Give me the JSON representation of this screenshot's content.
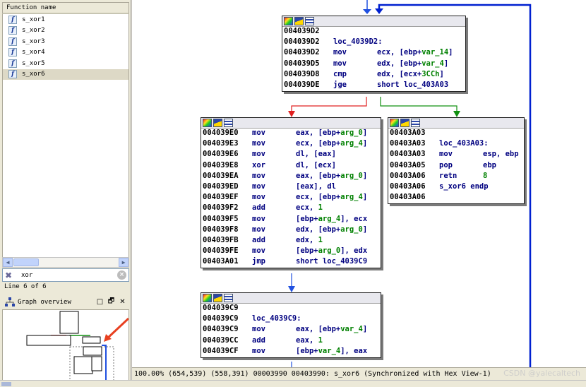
{
  "functions_panel": {
    "header": "Function name",
    "items": [
      {
        "name": "s_xor1"
      },
      {
        "name": "s_xor2"
      },
      {
        "name": "s_xor3"
      },
      {
        "name": "s_xor4"
      },
      {
        "name": "s_xor5"
      },
      {
        "name": "s_xor6",
        "selected": true
      }
    ],
    "filter_value": "xor",
    "line_status": "Line 6 of 6"
  },
  "graph_overview": {
    "title": "Graph overview",
    "controls": [
      "□",
      "🗗",
      "✕"
    ]
  },
  "graph": {
    "nodes": [
      {
        "id": "loc_4039D2",
        "lines": [
          {
            "addr": "004039D2"
          },
          {
            "addr": "004039D2",
            "label": "loc_4039D2:"
          },
          {
            "addr": "004039D2",
            "mn": "mov",
            "ops": [
              {
                "t": "ecx, [ebp+"
              },
              {
                "t": "var_14",
                "c": "num"
              },
              {
                "t": "]"
              }
            ]
          },
          {
            "addr": "004039D5",
            "mn": "mov",
            "ops": [
              {
                "t": "edx, [ebp+"
              },
              {
                "t": "var_4",
                "c": "num"
              },
              {
                "t": "]"
              }
            ]
          },
          {
            "addr": "004039D8",
            "mn": "cmp",
            "ops": [
              {
                "t": "edx, [ecx+"
              },
              {
                "t": "3CCh",
                "c": "num"
              },
              {
                "t": "]"
              }
            ]
          },
          {
            "addr": "004039DE",
            "mn": "jge",
            "ops": [
              {
                "t": "short loc_403A03"
              }
            ]
          }
        ]
      },
      {
        "id": "block_4039E0",
        "lines": [
          {
            "addr": "004039E0",
            "mn": "mov",
            "ops": [
              {
                "t": "eax, [ebp+"
              },
              {
                "t": "arg_0",
                "c": "num"
              },
              {
                "t": "]"
              }
            ]
          },
          {
            "addr": "004039E3",
            "mn": "mov",
            "ops": [
              {
                "t": "ecx, [ebp+"
              },
              {
                "t": "arg_4",
                "c": "num"
              },
              {
                "t": "]"
              }
            ]
          },
          {
            "addr": "004039E6",
            "mn": "mov",
            "ops": [
              {
                "t": "dl, [eax]"
              }
            ]
          },
          {
            "addr": "004039E8",
            "mn": "xor",
            "ops": [
              {
                "t": "dl, [ecx]"
              }
            ]
          },
          {
            "addr": "004039EA",
            "mn": "mov",
            "ops": [
              {
                "t": "eax, [ebp+"
              },
              {
                "t": "arg_0",
                "c": "num"
              },
              {
                "t": "]"
              }
            ]
          },
          {
            "addr": "004039ED",
            "mn": "mov",
            "ops": [
              {
                "t": "[eax], dl"
              }
            ]
          },
          {
            "addr": "004039EF",
            "mn": "mov",
            "ops": [
              {
                "t": "ecx, [ebp+"
              },
              {
                "t": "arg_4",
                "c": "num"
              },
              {
                "t": "]"
              }
            ]
          },
          {
            "addr": "004039F2",
            "mn": "add",
            "ops": [
              {
                "t": "ecx, "
              },
              {
                "t": "1",
                "c": "num"
              }
            ]
          },
          {
            "addr": "004039F5",
            "mn": "mov",
            "ops": [
              {
                "t": "[ebp+"
              },
              {
                "t": "arg_4",
                "c": "num"
              },
              {
                "t": "], ecx"
              }
            ]
          },
          {
            "addr": "004039F8",
            "mn": "mov",
            "ops": [
              {
                "t": "edx, [ebp+"
              },
              {
                "t": "arg_0",
                "c": "num"
              },
              {
                "t": "]"
              }
            ]
          },
          {
            "addr": "004039FB",
            "mn": "add",
            "ops": [
              {
                "t": "edx, "
              },
              {
                "t": "1",
                "c": "num"
              }
            ]
          },
          {
            "addr": "004039FE",
            "mn": "mov",
            "ops": [
              {
                "t": "[ebp+"
              },
              {
                "t": "arg_0",
                "c": "num"
              },
              {
                "t": "], edx"
              }
            ]
          },
          {
            "addr": "00403A01",
            "mn": "jmp",
            "ops": [
              {
                "t": "short loc_4039C9"
              }
            ]
          }
        ]
      },
      {
        "id": "loc_403A03",
        "lines": [
          {
            "addr": "00403A03"
          },
          {
            "addr": "00403A03",
            "label": "loc_403A03:"
          },
          {
            "addr": "00403A03",
            "mn": "mov",
            "ops": [
              {
                "t": "esp, ebp"
              }
            ]
          },
          {
            "addr": "00403A05",
            "mn": "pop",
            "ops": [
              {
                "t": "ebp"
              }
            ]
          },
          {
            "addr": "00403A06",
            "mn": "retn",
            "ops": [
              {
                "t": "8",
                "c": "num"
              }
            ]
          },
          {
            "addr": "00403A06",
            "label": "s_xor6 endp"
          },
          {
            "addr": "00403A06"
          }
        ]
      },
      {
        "id": "loc_4039C9",
        "lines": [
          {
            "addr": "004039C9"
          },
          {
            "addr": "004039C9",
            "label": "loc_4039C9:"
          },
          {
            "addr": "004039C9",
            "mn": "mov",
            "ops": [
              {
                "t": "eax, [ebp+"
              },
              {
                "t": "var_4",
                "c": "num"
              },
              {
                "t": "]"
              }
            ]
          },
          {
            "addr": "004039CC",
            "mn": "add",
            "ops": [
              {
                "t": "eax, "
              },
              {
                "t": "1",
                "c": "num"
              }
            ]
          },
          {
            "addr": "004039CF",
            "mn": "mov",
            "ops": [
              {
                "t": "[ebp+"
              },
              {
                "t": "var_4",
                "c": "num"
              },
              {
                "t": "], eax"
              }
            ]
          }
        ]
      }
    ]
  },
  "colors": {
    "edge_false": "#e02020",
    "edge_true": "#109010",
    "edge_flow": "#2050e0",
    "loop_edge": "#0020d0"
  },
  "status_bar": {
    "text": "100.00% (654,539) (558,391) 00003990 00403990: s_xor6 (Synchronized with Hex View-1)"
  },
  "watermark": "CSDN @yalecaltech"
}
